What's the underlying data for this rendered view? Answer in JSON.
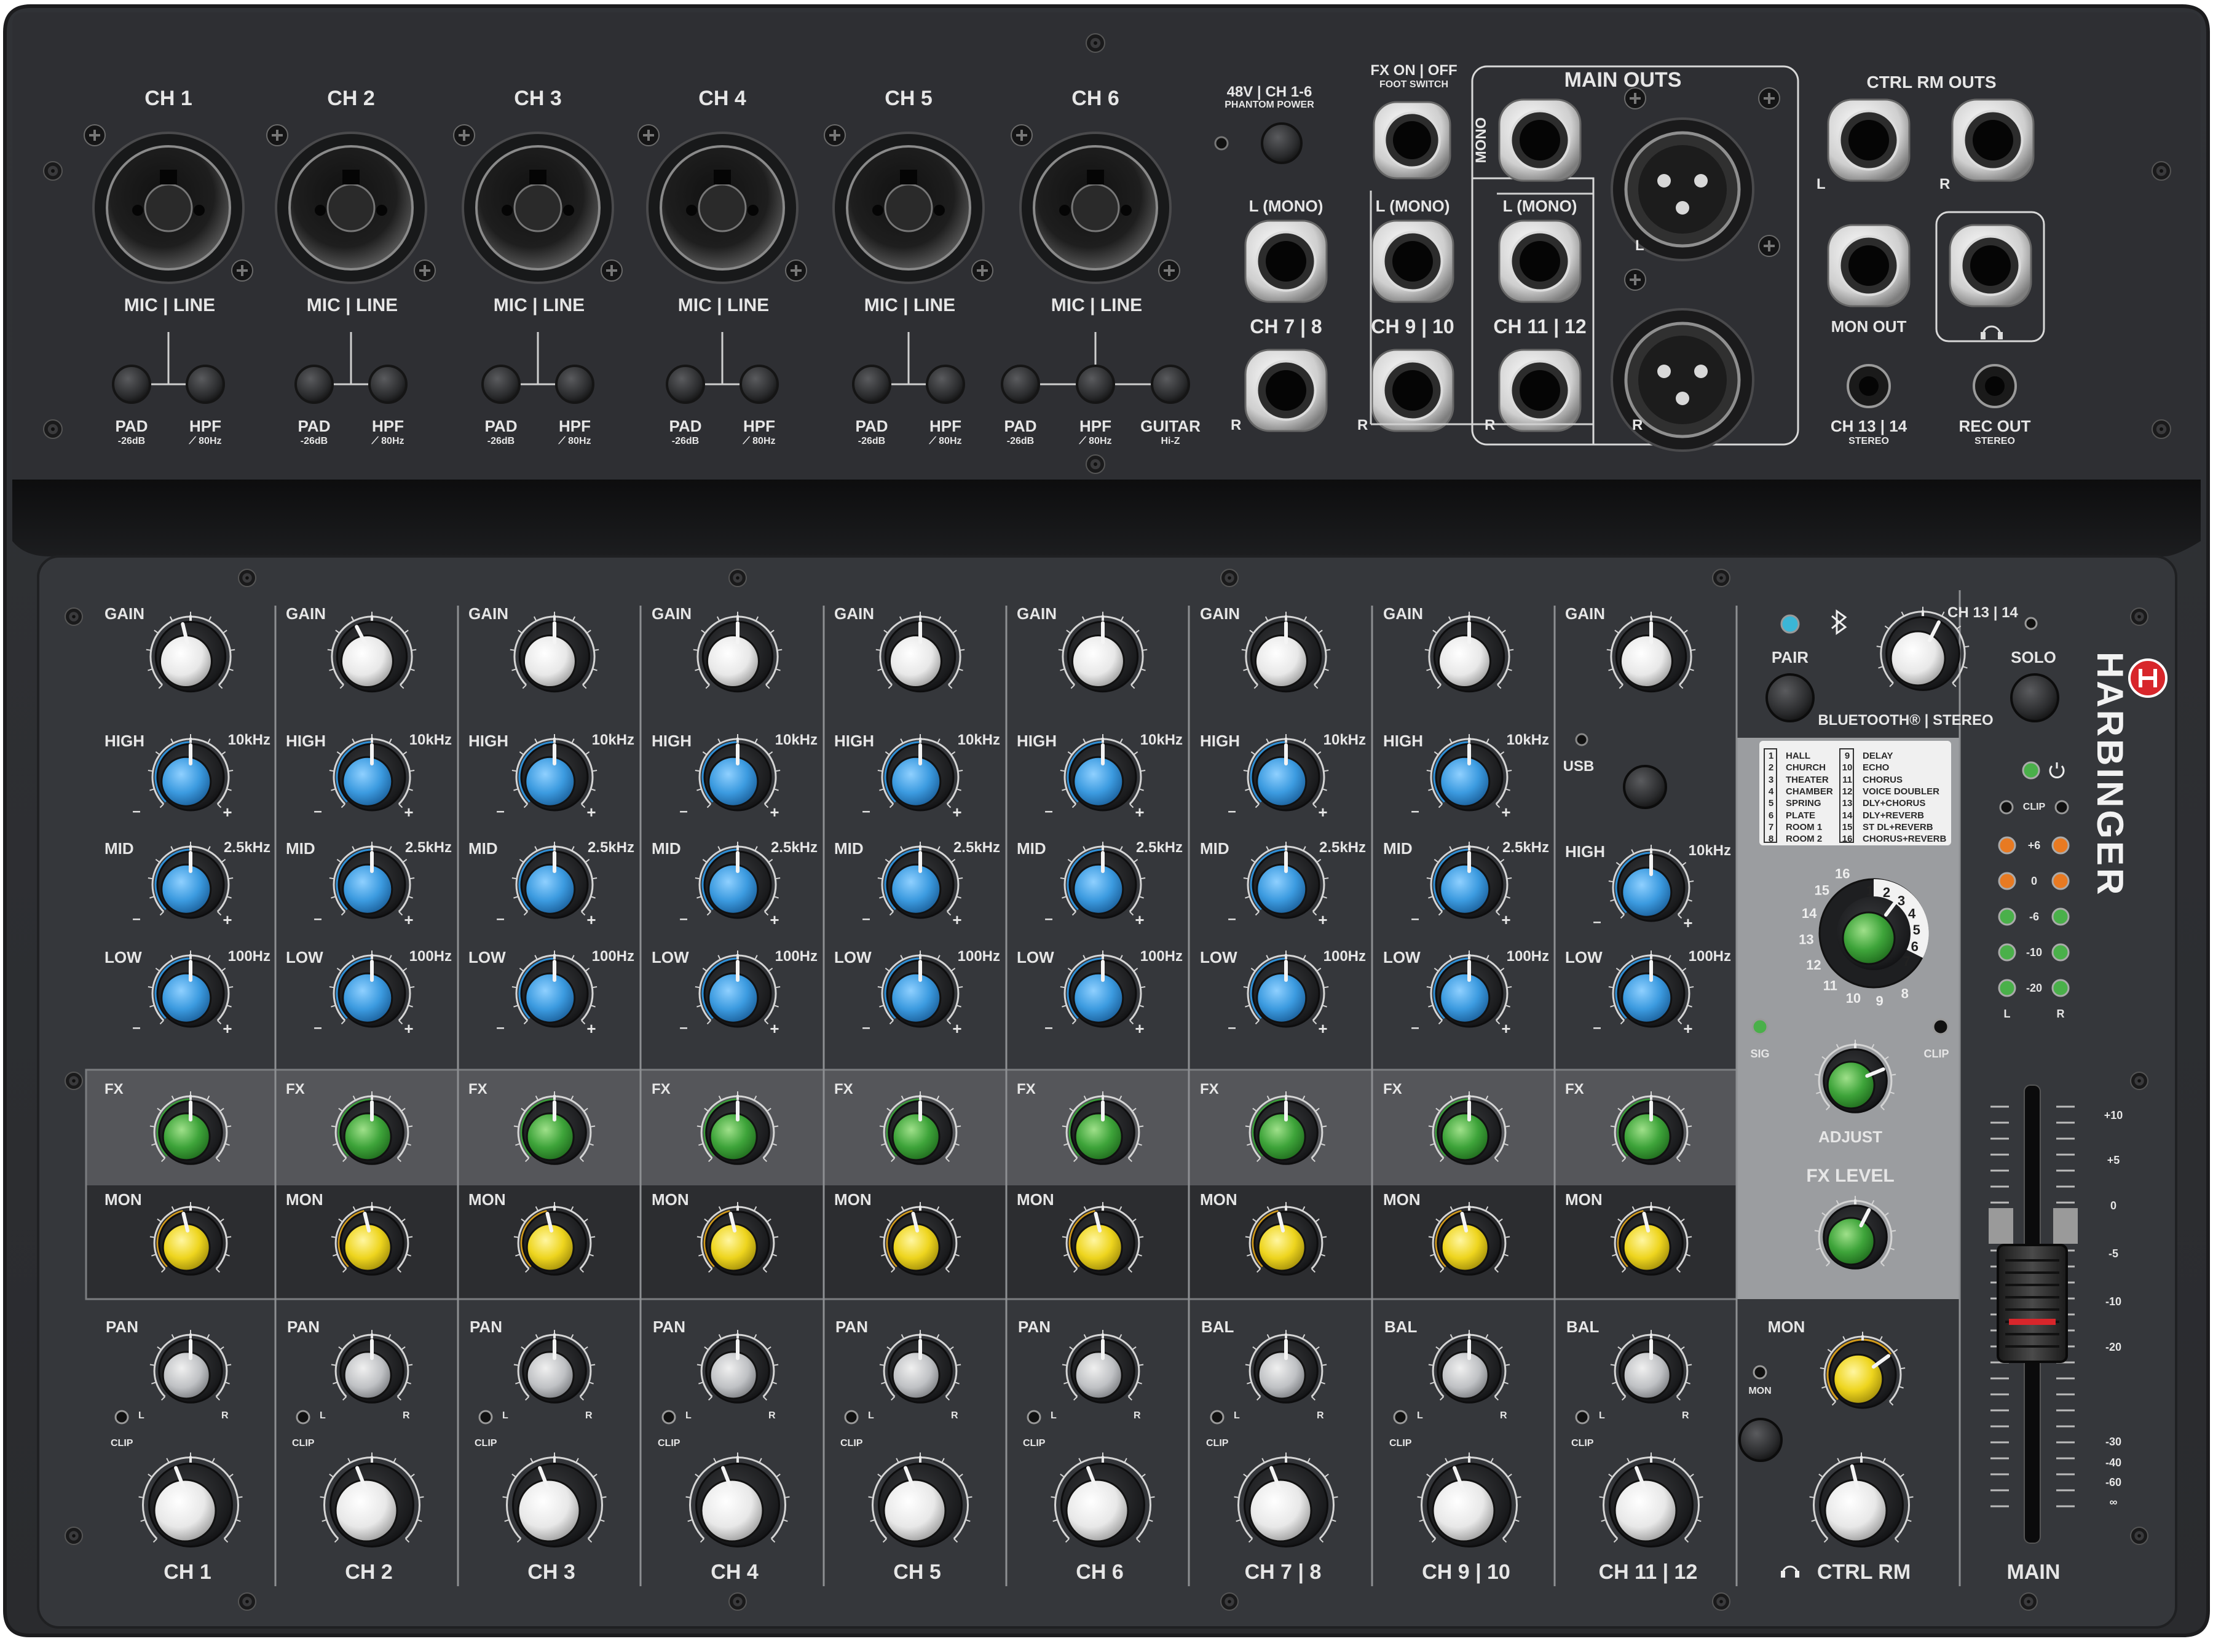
{
  "brand": "HARBINGER",
  "colors": {
    "body": "#2b2c2f",
    "panel": "#34363a",
    "eq_knob": "#2f8fd6",
    "fx_knob": "#3a9d3a",
    "mon_knob": "#e4cf1c",
    "gain_knob": "#f2f2f2",
    "brand_red": "#d8262b"
  },
  "rear": {
    "channels": [
      {
        "name": "CH 1",
        "input": "MIC | LINE",
        "buttons": [
          {
            "label": "PAD",
            "sub": "-26dB"
          },
          {
            "label": "HPF",
            "sub": "⟋ 80Hz"
          }
        ]
      },
      {
        "name": "CH 2",
        "input": "MIC | LINE",
        "buttons": [
          {
            "label": "PAD",
            "sub": "-26dB"
          },
          {
            "label": "HPF",
            "sub": "⟋ 80Hz"
          }
        ]
      },
      {
        "name": "CH 3",
        "input": "MIC | LINE",
        "buttons": [
          {
            "label": "PAD",
            "sub": "-26dB"
          },
          {
            "label": "HPF",
            "sub": "⟋ 80Hz"
          }
        ]
      },
      {
        "name": "CH 4",
        "input": "MIC | LINE",
        "buttons": [
          {
            "label": "PAD",
            "sub": "-26dB"
          },
          {
            "label": "HPF",
            "sub": "⟋ 80Hz"
          }
        ]
      },
      {
        "name": "CH 5",
        "input": "MIC | LINE",
        "buttons": [
          {
            "label": "PAD",
            "sub": "-26dB"
          },
          {
            "label": "HPF",
            "sub": "⟋ 80Hz"
          }
        ]
      },
      {
        "name": "CH 6",
        "input": "MIC | LINE",
        "buttons": [
          {
            "label": "PAD",
            "sub": "-26dB"
          },
          {
            "label": "HPF",
            "sub": "⟋ 80Hz"
          },
          {
            "label": "GUITAR",
            "sub": "Hi-Z"
          }
        ]
      }
    ],
    "phantom": {
      "label": "48V | CH 1-6",
      "sub": "PHANTOM POWER"
    },
    "fx_footswitch": {
      "label": "FX ON | OFF",
      "sub": "FOOT SWITCH"
    },
    "stereo_inputs": [
      {
        "top": "L (MONO)",
        "name": "CH 7 | 8",
        "bottom": "R"
      },
      {
        "top": "L (MONO)",
        "name": "CH 9 | 10",
        "bottom": "R"
      },
      {
        "top": "L (MONO)",
        "name": "CH 11 | 12",
        "bottom": "R"
      }
    ],
    "main_outs": {
      "label": "MAIN OUTS",
      "mono": "MONO",
      "left": "L",
      "right": "R"
    },
    "ctrl_rm_outs": {
      "label": "CTRL RM OUTS",
      "left": "L",
      "right": "R"
    },
    "mon_out": "MON OUT",
    "headphone_icon": "headphone-icon",
    "ch1314": {
      "label": "CH 13 | 14",
      "sub": "STEREO"
    },
    "rec_out": {
      "label": "REC OUT",
      "sub": "STEREO"
    }
  },
  "strips": [
    {
      "name": "CH 1",
      "pan": "PAN",
      "eq": "3",
      "gain": 0.45
    },
    {
      "name": "CH 2",
      "pan": "PAN",
      "eq": "3",
      "gain": 0.4
    },
    {
      "name": "CH 3",
      "pan": "PAN",
      "eq": "3",
      "gain": 0.5
    },
    {
      "name": "CH 4",
      "pan": "PAN",
      "eq": "3",
      "gain": 0.5
    },
    {
      "name": "CH 5",
      "pan": "PAN",
      "eq": "3",
      "gain": 0.5
    },
    {
      "name": "CH 6",
      "pan": "PAN",
      "eq": "3",
      "gain": 0.5
    },
    {
      "name": "CH 7 | 8",
      "pan": "BAL",
      "eq": "3",
      "gain": 0.5
    },
    {
      "name": "CH 9 | 10",
      "pan": "BAL",
      "eq": "3",
      "gain": 0.5
    },
    {
      "name": "CH 11 | 12",
      "pan": "BAL",
      "eq": "2",
      "gain": 0.5
    }
  ],
  "strip_labels": {
    "gain": "GAIN",
    "high": "HIGH",
    "high_freq": "10kHz",
    "mid": "MID",
    "mid_freq": "2.5kHz",
    "low": "LOW",
    "low_freq": "100Hz",
    "fx": "FX",
    "mon": "MON",
    "clip": "CLIP",
    "l": "L",
    "r": "R",
    "minus": "–",
    "plus": "+",
    "usb": "USB"
  },
  "master": {
    "pair": "PAIR",
    "solo": "SOLO",
    "ch1314": "CH 13 | 14",
    "bluetooth": "BLUETOOTH® | STEREO",
    "fx_programs": [
      {
        "n": "1",
        "name": "HALL"
      },
      {
        "n": "2",
        "name": "CHURCH"
      },
      {
        "n": "3",
        "name": "THEATER"
      },
      {
        "n": "4",
        "name": "CHAMBER"
      },
      {
        "n": "5",
        "name": "SPRING"
      },
      {
        "n": "6",
        "name": "PLATE"
      },
      {
        "n": "7",
        "name": "ROOM 1"
      },
      {
        "n": "8",
        "name": "ROOM 2"
      },
      {
        "n": "9",
        "name": "DELAY"
      },
      {
        "n": "10",
        "name": "ECHO"
      },
      {
        "n": "11",
        "name": "CHORUS"
      },
      {
        "n": "12",
        "name": "VOICE DOUBLER"
      },
      {
        "n": "13",
        "name": "DLY+CHORUS"
      },
      {
        "n": "14",
        "name": "DLY+REVERB"
      },
      {
        "n": "15",
        "name": "ST DL+REVERB"
      },
      {
        "n": "16",
        "name": "CHORUS+REVERB"
      }
    ],
    "sig": "SIG",
    "clip": "CLIP",
    "adjust": "ADJUST",
    "fx_level": "FX LEVEL",
    "mon": "MON",
    "mon_btn": "MON",
    "ctrl_rm": "CTRL RM",
    "meter": {
      "clip": "CLIP",
      "levels": [
        "+6",
        "0",
        "-6",
        "-10",
        "-20"
      ],
      "l": "L",
      "r": "R"
    },
    "main": "MAIN",
    "fader_scale": [
      "+10",
      "+5",
      "0",
      "-5",
      "-10",
      "-20",
      "-30",
      "-40",
      "-60",
      "∞"
    ]
  }
}
